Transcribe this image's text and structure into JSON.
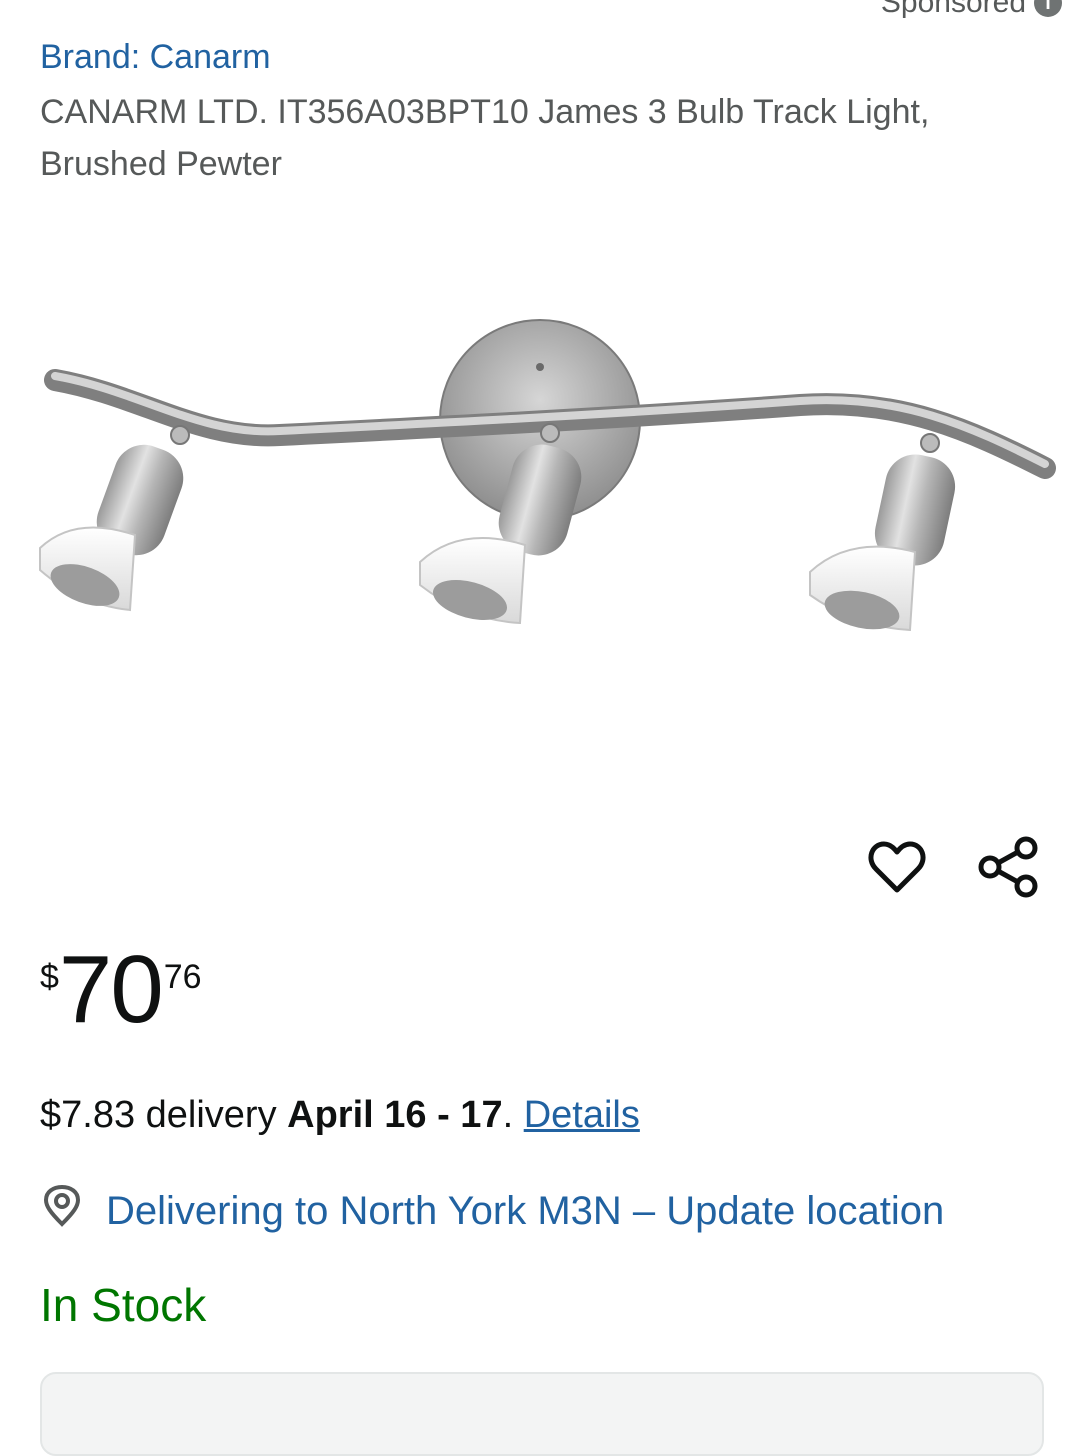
{
  "header": {
    "sponsored_label": "Sponsored"
  },
  "product": {
    "brand": "Brand: Canarm",
    "title": "CANARM LTD. IT356A03BPT10 James 3 Bulb Track Light, Brushed Pewter"
  },
  "actions": {
    "wishlist_icon": "heart-icon",
    "share_icon": "share-icon"
  },
  "price": {
    "symbol": "$",
    "whole": "70",
    "fraction": "76"
  },
  "delivery": {
    "prefix": "$7.83 delivery ",
    "dates": "April 16 - 17",
    "separator": ". ",
    "details_link": "Details"
  },
  "location": {
    "text": "Delivering to North York M3N – Update location",
    "icon": "location-pin-icon"
  },
  "stock": {
    "status": "In Stock"
  },
  "colors": {
    "link": "#2162a1",
    "in_stock": "#007600",
    "secondary_text": "#565959",
    "primary_text": "#0f1111"
  }
}
